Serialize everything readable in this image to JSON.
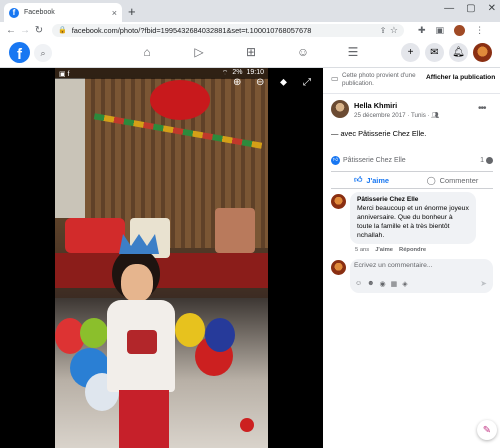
{
  "browser": {
    "tab_title": "Facebook",
    "tab_close": "×",
    "new_tab": "+",
    "url": "facebook.com/photo/?fbid=1995432684032881&set=t.100010768057678",
    "window_controls": [
      "—",
      "▢",
      "✕"
    ]
  },
  "fb": {
    "logo_letter": "f"
  },
  "photo": {
    "status_time": "19:10",
    "status_battery": "2%",
    "status_left": "▣ f"
  },
  "side": {
    "notice_text": "Cette photo provient d'une publication.",
    "notice_button": "Afficher la publication",
    "author_name": "Hella Khmiri",
    "post_meta": "25 décembre 2017 · Tunis · ",
    "with_text": "— avec Pâtisserie Chez Elle.",
    "reactor_name": "Pâtisserie Chez Elle",
    "comment_count": "1",
    "like_label": "J'aime",
    "comment_label": "Commenter",
    "comment": {
      "author": "Pâtisserie Chez Elle",
      "text": "Merci beaucoup et un énorme joyeux anniversaire. Que du bonheur à toute la famille et à très bientôt nchallah.",
      "time": "5 ans",
      "like": "J'aime",
      "reply": "Répondre"
    },
    "comment_placeholder": "Écrivez un commentaire..."
  }
}
